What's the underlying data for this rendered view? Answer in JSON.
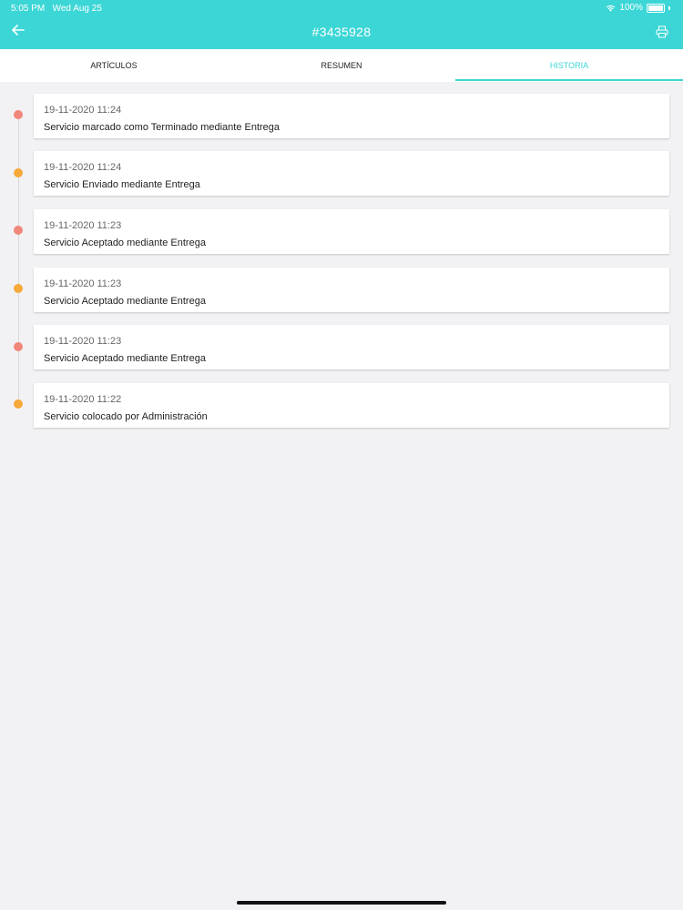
{
  "status": {
    "time": "5:05 PM",
    "date": "Wed Aug 25",
    "battery": "100%"
  },
  "header": {
    "title": "#3435928",
    "back_icon": "arrow-left-icon",
    "print_icon": "printer-icon"
  },
  "tabs": [
    {
      "label": "ARTÍCULOS",
      "active": false
    },
    {
      "label": "RESUMEN",
      "active": false
    },
    {
      "label": "HISTORIA",
      "active": true
    }
  ],
  "colors": {
    "accent": "#3dd6d6",
    "dot_red": "#f0877a",
    "dot_orange": "#f6a838"
  },
  "history": [
    {
      "timestamp": "19-11-2020 11:24",
      "message": "Servicio marcado como Terminado mediante Entrega",
      "dot": "red"
    },
    {
      "timestamp": "19-11-2020 11:24",
      "message": "Servicio Enviado mediante Entrega",
      "dot": "orange"
    },
    {
      "timestamp": "19-11-2020 11:23",
      "message": "Servicio Aceptado mediante Entrega",
      "dot": "red"
    },
    {
      "timestamp": "19-11-2020 11:23",
      "message": "Servicio Aceptado mediante Entrega",
      "dot": "orange"
    },
    {
      "timestamp": "19-11-2020 11:23",
      "message": "Servicio Aceptado mediante Entrega",
      "dot": "red"
    },
    {
      "timestamp": "19-11-2020 11:22",
      "message": "Servicio colocado por Administración",
      "dot": "orange"
    }
  ]
}
